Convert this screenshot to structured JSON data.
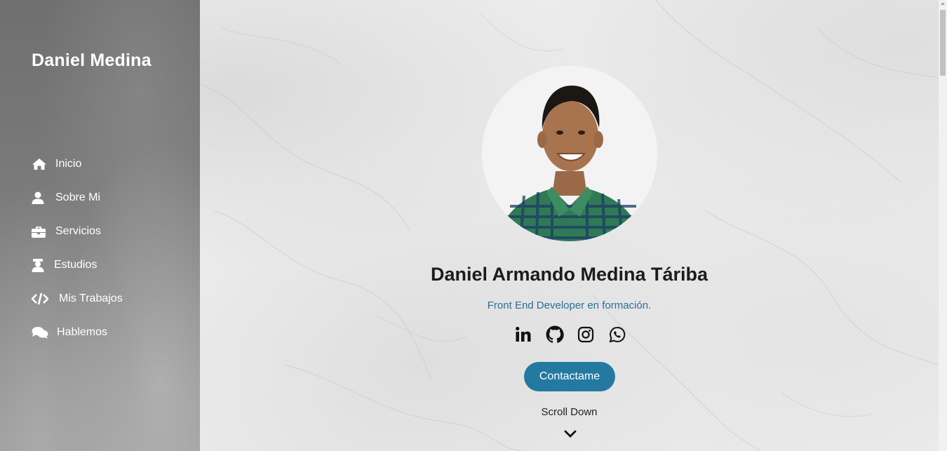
{
  "sidebar": {
    "brand": "Daniel Medina",
    "items": [
      {
        "label": "Inicio",
        "icon": "home-icon"
      },
      {
        "label": "Sobre Mi",
        "icon": "user-icon"
      },
      {
        "label": "Servicios",
        "icon": "briefcase-icon"
      },
      {
        "label": "Estudios",
        "icon": "graduate-icon"
      },
      {
        "label": "Mis Trabajos",
        "icon": "code-icon"
      },
      {
        "label": "Hablemos",
        "icon": "chat-icon"
      }
    ]
  },
  "hero": {
    "name": "Daniel Armando Medina Táriba",
    "role": "Front End Developer en formación.",
    "socials": [
      "linkedin-icon",
      "github-icon",
      "instagram-icon",
      "whatsapp-icon"
    ],
    "contact_label": "Contactame",
    "scroll_label": "Scroll Down"
  },
  "colors": {
    "accent": "#2479a0",
    "role_text": "#2a6f96",
    "sidebar_bg": "#7a7a7a"
  }
}
